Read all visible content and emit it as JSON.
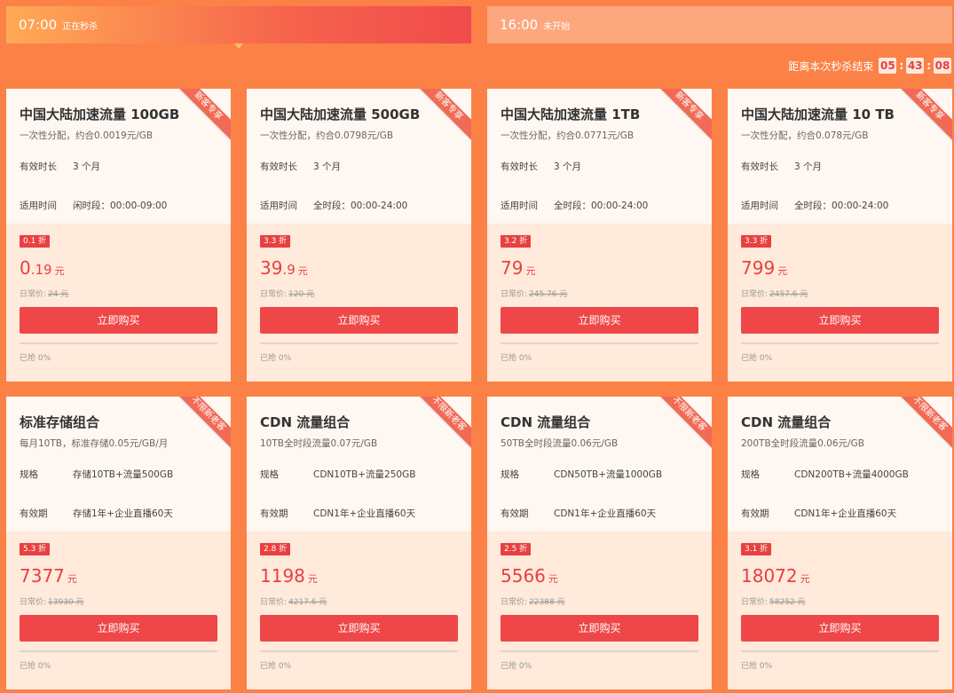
{
  "tabs": [
    {
      "time": "07:00",
      "status": "正在秒杀"
    },
    {
      "time": "16:00",
      "status": "未开始"
    }
  ],
  "countdown": {
    "label": "距离本次秒杀结束",
    "hours": "05",
    "minutes": "43",
    "seconds": "08",
    "sep": ":"
  },
  "buy_label": "立即购买",
  "orig_label": "日常价:",
  "cards": [
    {
      "ribbon": "新客专享",
      "title": "中国大陆加速流量 100GB",
      "subtitle": "一次性分配，约合0.0019元/GB",
      "r1k": "有效时长",
      "r1v": "3 个月",
      "r2k": "适用时间",
      "r2v": "闲时段：00:00-09:00",
      "badge": "0.1 折",
      "price_int": "0",
      "price_dec": ".19",
      "unit": "元",
      "orig": "24 元",
      "sold": "已抢 0%"
    },
    {
      "ribbon": "新客专享",
      "title": "中国大陆加速流量 500GB",
      "subtitle": "一次性分配，约合0.0798元/GB",
      "r1k": "有效时长",
      "r1v": "3 个月",
      "r2k": "适用时间",
      "r2v": "全时段：00:00-24:00",
      "badge": "3.3 折",
      "price_int": "39",
      "price_dec": ".9",
      "unit": "元",
      "orig": "120 元",
      "sold": "已抢 0%"
    },
    {
      "ribbon": "新客专享",
      "title": "中国大陆加速流量 1TB",
      "subtitle": "一次性分配，约合0.0771元/GB",
      "r1k": "有效时长",
      "r1v": "3 个月",
      "r2k": "适用时间",
      "r2v": "全时段：00:00-24:00",
      "badge": "3.2 折",
      "price_int": "79",
      "price_dec": "",
      "unit": "元",
      "orig": "245.76 元",
      "sold": "已抢 0%"
    },
    {
      "ribbon": "新客专享",
      "title": "中国大陆加速流量 10 TB",
      "subtitle": "一次性分配，约合0.078元/GB",
      "r1k": "有效时长",
      "r1v": "3 个月",
      "r2k": "适用时间",
      "r2v": "全时段：00:00-24:00",
      "badge": "3.3 折",
      "price_int": "799",
      "price_dec": "",
      "unit": "元",
      "orig": "2457.6 元",
      "sold": "已抢 0%"
    },
    {
      "ribbon": "不限新老客",
      "title": "标准存储组合",
      "subtitle": "每月10TB，标准存储0.05元/GB/月",
      "r1k": "规格",
      "r1v": "存储10TB+流量500GB",
      "r2k": "有效期",
      "r2v": "存储1年+企业直播60天",
      "badge": "5.3 折",
      "price_int": "7377",
      "price_dec": "",
      "unit": "元",
      "orig": "13930 元",
      "sold": "已抢 0%"
    },
    {
      "ribbon": "不限新老客",
      "title": "CDN 流量组合",
      "subtitle": "10TB全时段流量0.07元/GB",
      "r1k": "规格",
      "r1v": "CDN10TB+流量250GB",
      "r2k": "有效期",
      "r2v": "CDN1年+企业直播60天",
      "badge": "2.8 折",
      "price_int": "1198",
      "price_dec": "",
      "unit": "元",
      "orig": "4217.6 元",
      "sold": "已抢 0%"
    },
    {
      "ribbon": "不限新老客",
      "title": "CDN 流量组合",
      "subtitle": "50TB全时段流量0.06元/GB",
      "r1k": "规格",
      "r1v": "CDN50TB+流量1000GB",
      "r2k": "有效期",
      "r2v": "CDN1年+企业直播60天",
      "badge": "2.5 折",
      "price_int": "5566",
      "price_dec": "",
      "unit": "元",
      "orig": "22388 元",
      "sold": "已抢 0%"
    },
    {
      "ribbon": "不限新老客",
      "title": "CDN 流量组合",
      "subtitle": "200TB全时段流量0.06元/GB",
      "r1k": "规格",
      "r1v": "CDN200TB+流量4000GB",
      "r2k": "有效期",
      "r2v": "CDN1年+企业直播60天",
      "badge": "3.1 折",
      "price_int": "18072",
      "price_dec": "",
      "unit": "元",
      "orig": "58252 元",
      "sold": "已抢 0%"
    }
  ],
  "colors": {
    "background": "#fb8146",
    "accent": "#ef4647",
    "card": "#fff7f1",
    "card_bottom": "#ffeadb"
  }
}
